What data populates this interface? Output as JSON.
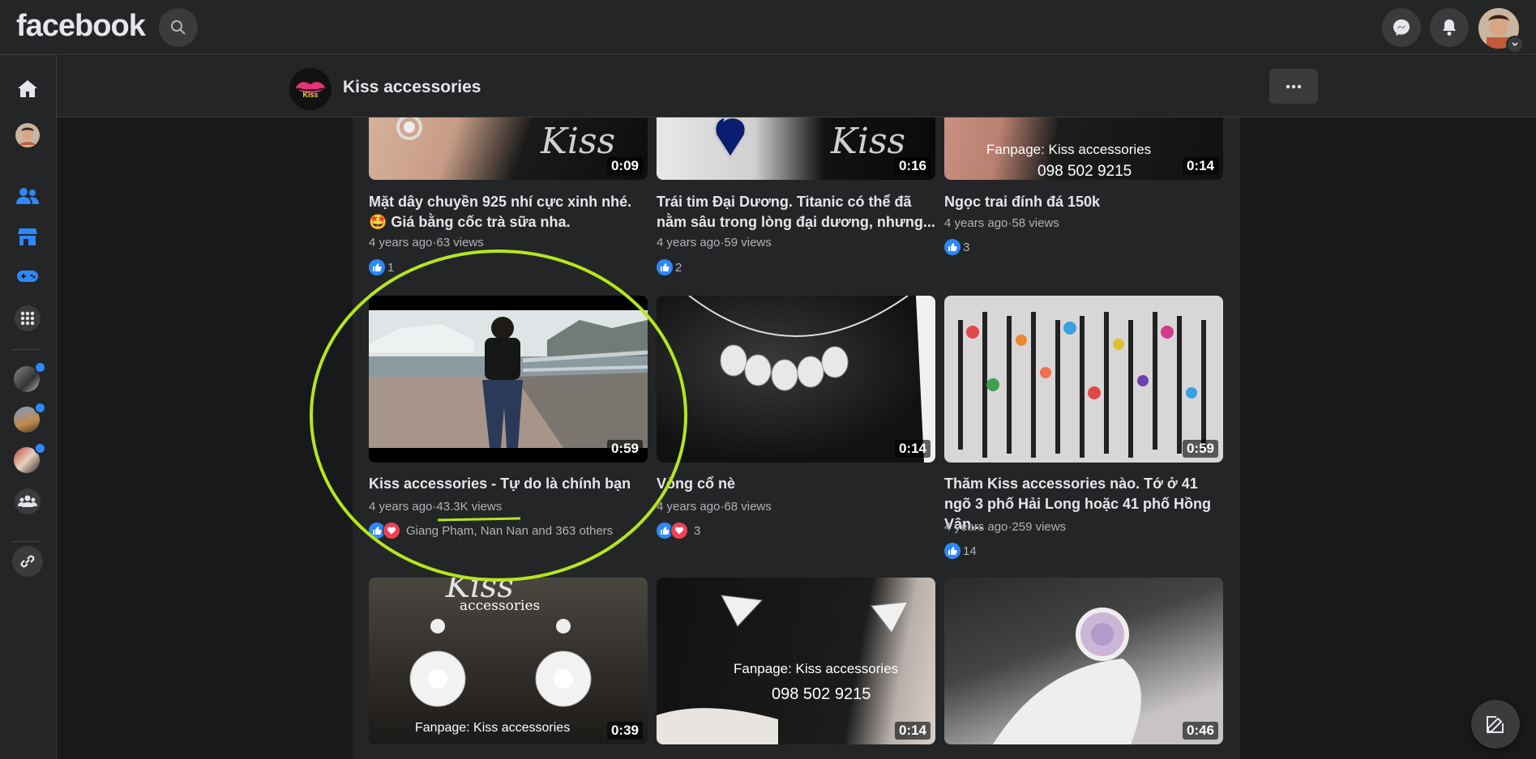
{
  "topbar": {
    "logo": "facebook"
  },
  "page": {
    "name": "Kiss accessories",
    "logo_text": "Kiss"
  },
  "videos": [
    {
      "title": "Mặt dây chuyền 925 nhí cực xinh nhé. 🤩 Giá bằng cốc trà sữa nha.",
      "duration": "0:09",
      "age": "4 years ago",
      "views": "63 views",
      "reactions": "1"
    },
    {
      "title": "Trái tim Đại Dương. Titanic có thể đã nằm sâu trong lòng đại dương, nhưng...",
      "duration": "0:16",
      "age": "4 years ago",
      "views": "59 views",
      "reactions": "2"
    },
    {
      "title": "Ngọc trai đính đá 150k",
      "duration": "0:14",
      "age": "4 years ago",
      "views": "58 views",
      "reactions": "3"
    },
    {
      "title": "Kiss accessories - Tự do là chính bạn",
      "duration": "0:59",
      "age": "4 years ago",
      "views": "43.3K views",
      "reactions": "Giang Phạm, Nan Nan and 363 others"
    },
    {
      "title": "Vòng cổ nè",
      "duration": "0:14",
      "age": "4 years ago",
      "views": "68 views",
      "reactions": "3"
    },
    {
      "title": "Thăm Kiss accessories nào. Tớ ở 41 ngõ 3 phố Hải Long hoặc 41 phố Hồng Vân...",
      "duration": "0:59",
      "age": "4 years ago",
      "views": "259 views",
      "reactions": "14"
    },
    {
      "duration": "0:39"
    },
    {
      "duration": "0:14"
    },
    {
      "duration": "0:46"
    }
  ],
  "thumb_text": {
    "kiss": "Kiss",
    "accessories": "accessories",
    "fanpage": "Fanpage: Kiss accessories",
    "phone": "098 502 9215"
  },
  "meta_separator": "·",
  "colors": {
    "background": "#18191a",
    "surface": "#242526",
    "accent": "#2d88ff",
    "highlight_annotation": "#b5e61d"
  },
  "icons": [
    "search-icon",
    "messenger-icon",
    "bell-icon",
    "home-icon",
    "friends-icon",
    "marketplace-icon",
    "gaming-icon",
    "menu-grid-icon",
    "groups-icon",
    "link-icon",
    "more-icon",
    "edit-icon",
    "like-icon",
    "love-icon"
  ]
}
